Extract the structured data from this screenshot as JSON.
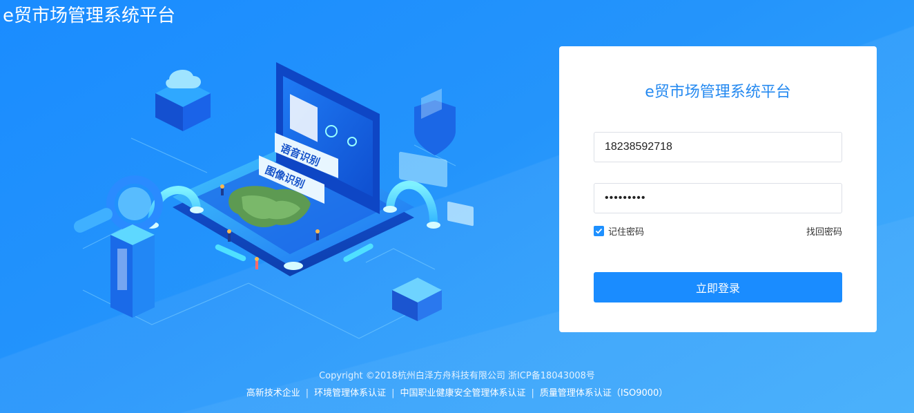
{
  "app": {
    "title": "e贸市场管理系统平台"
  },
  "illustration": {
    "badge_voice": "语音识别",
    "badge_image": "图像识别"
  },
  "login": {
    "title": "e贸市场管理系统平台",
    "username_value": "18238592718",
    "password_value": "•••••••••",
    "remember_label": "记住密码",
    "remember_checked": true,
    "forgot_label": "找回密码",
    "submit_label": "立即登录"
  },
  "footer": {
    "copyright": "Copyright ©2018杭州白泽方舟科技有限公司 浙ICP备18043008号",
    "certifications": [
      "高新技术企业",
      "环境管理体系认证",
      "中国职业健康安全管理体系认证",
      "质量管理体系认证（ISO9000）"
    ],
    "separator": "|"
  },
  "colors": {
    "background": "#1a8cff",
    "accent": "#1a8cff",
    "title_blue": "#2489f0"
  }
}
